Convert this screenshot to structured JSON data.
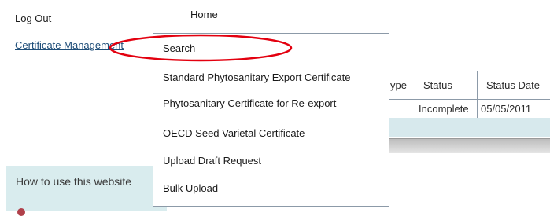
{
  "nav": {
    "logout": "Log Out",
    "certificate_management": "Certificate Management"
  },
  "help": {
    "text": "How to use this website"
  },
  "table": {
    "header_type_fragment": "ype",
    "header_status": "Status",
    "header_status_date": "Status Date",
    "row_status": "Incomplete",
    "row_status_date": "05/05/2011"
  },
  "menu": {
    "home": "Home",
    "items": [
      "Search",
      "Standard Phytosanitary Export Certificate",
      "Phytosanitary Certificate for Re-export",
      "OECD Seed Varietal Certificate",
      "Upload Draft Request",
      "Bulk Upload"
    ]
  },
  "colors": {
    "annotation": "#e3000f",
    "help_bg": "#d9ecee",
    "link": "#1f4e79"
  }
}
